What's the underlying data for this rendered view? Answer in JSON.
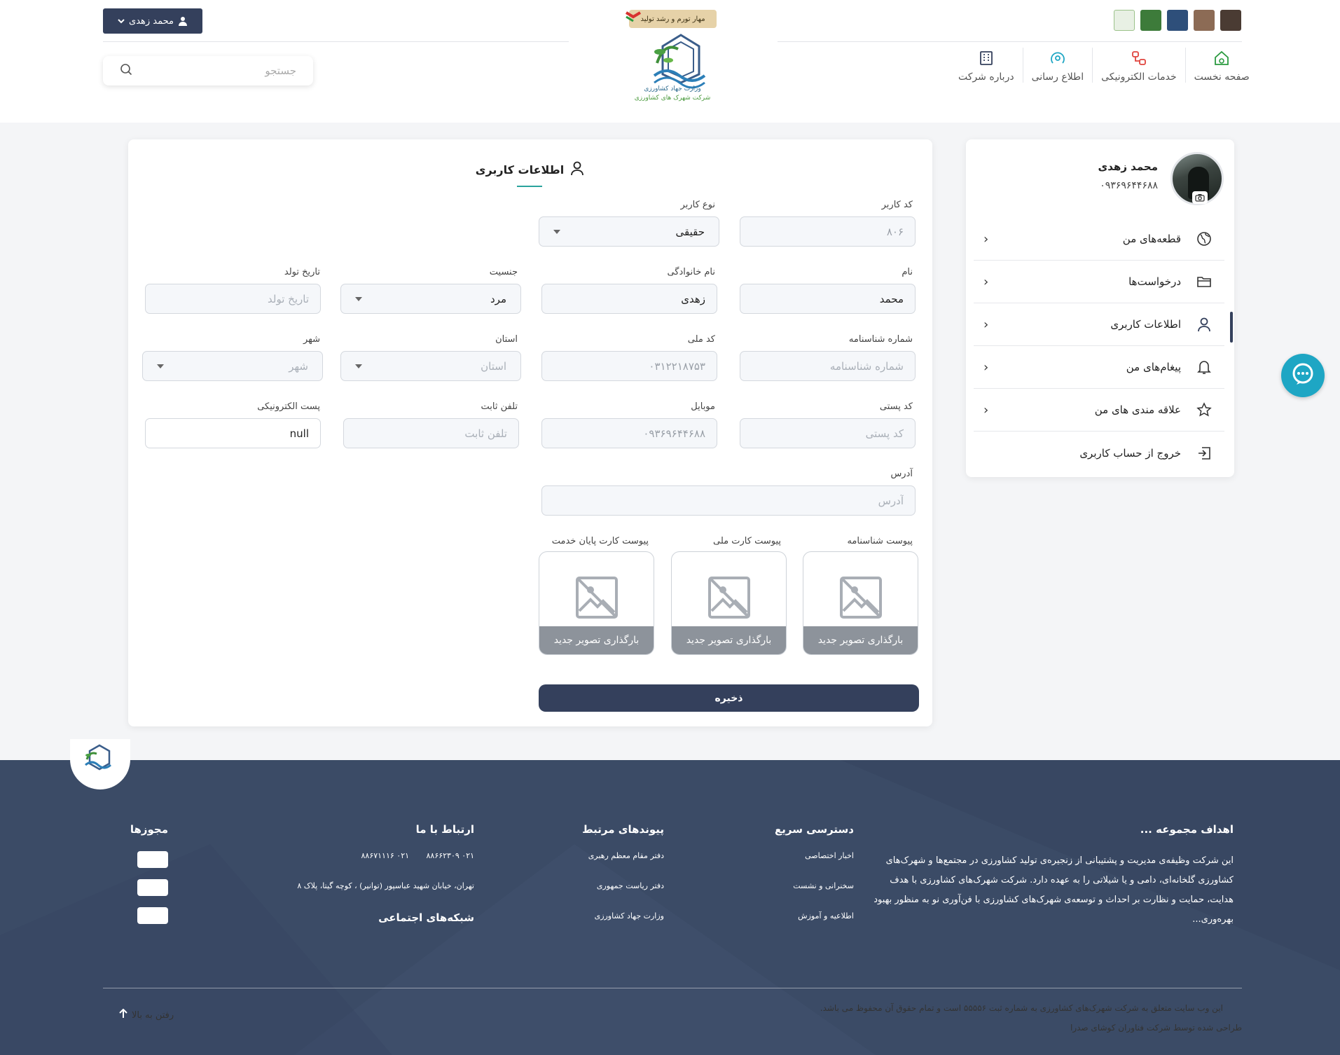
{
  "header": {
    "user_button_label": "محمد زهدی",
    "search_placeholder": "جستجو",
    "slogan_badge": "مهار تورم و رشد تولید",
    "logo_caption_ministry": "وزارت جهاد کشاورزی",
    "logo_caption_company": "شرکت شهرک های کشاورزی",
    "nav": [
      {
        "label": "صفحه نخست",
        "icon": "home-icon"
      },
      {
        "label": "خدمات الکترونیکی",
        "icon": "services-icon"
      },
      {
        "label": "اطلاع رسانی",
        "icon": "broadcast-icon"
      },
      {
        "label": "درباره شرکت",
        "icon": "building-icon"
      }
    ]
  },
  "form": {
    "title": "اطلاعات کاربری",
    "user_code": {
      "label": "کد کاربر",
      "value": "۸۰۶"
    },
    "user_type": {
      "label": "نوع کاربر",
      "value": "حقیقی"
    },
    "first_name": {
      "label": "نام",
      "value": "محمد"
    },
    "last_name": {
      "label": "نام خانوادگی",
      "value": "زهدی"
    },
    "gender": {
      "label": "جنسیت",
      "value": "مرد"
    },
    "birth_date": {
      "label": "تاریخ تولد",
      "placeholder": "تاریخ تولد"
    },
    "id_number": {
      "label": "شماره شناسنامه",
      "placeholder": "شماره شناسنامه"
    },
    "national_code": {
      "label": "کد ملی",
      "value": "۰۳۱۲۲۱۸۷۵۳"
    },
    "province": {
      "label": "استان",
      "placeholder": "استان"
    },
    "city": {
      "label": "شهر",
      "placeholder": "شهر"
    },
    "postal_code": {
      "label": "کد پستی",
      "placeholder": "کد پستی"
    },
    "mobile": {
      "label": "موبایل",
      "value": "۰۹۳۶۹۶۴۴۶۸۸"
    },
    "phone": {
      "label": "تلفن ثابت",
      "placeholder": "تلفن ثابت"
    },
    "email": {
      "label": "پست الکترونیکی",
      "value": "null"
    },
    "address": {
      "label": "آدرس",
      "placeholder": "آدرس"
    },
    "uploads": [
      {
        "label": "پیوست شناسنامه",
        "button": "بارگذاری تصویر جدید"
      },
      {
        "label": "پیوست کارت ملی",
        "button": "بارگذاری تصویر جدید"
      },
      {
        "label": "پیوست کارت پایان خدمت",
        "button": "بارگذاری تصویر جدید"
      }
    ],
    "save_label": "ذخیره"
  },
  "sidebar": {
    "name": "محمد زهدی",
    "phone": "۰۹۳۶۹۶۴۴۶۸۸",
    "items": [
      {
        "label": "قطعه‌های من",
        "icon": "globe-icon"
      },
      {
        "label": "درخواست‌ها",
        "icon": "folder-icon"
      },
      {
        "label": "اطلاعات کاربری",
        "icon": "user-icon",
        "active": true
      },
      {
        "label": "پیغام‌های من",
        "icon": "bell-icon"
      },
      {
        "label": "علاقه مندی های من",
        "icon": "star-icon"
      },
      {
        "label": "خروج از حساب کاربری",
        "icon": "logout-icon"
      }
    ]
  },
  "footer": {
    "goals_title": "اهداف مجموعه ...",
    "goals_text": "این شرکت وظیفه‌ی مدیریت و پشتیبانی از زنجیره‌ی تولید کشاورزی در مجتمع‌ها و شهرک‌های کشاورزی گلخانه‌ای، دامی و یا شیلاتی را به عهده دارد. شرکت شهرک‌های کشاورزی با هدف هدایت، حمایت و نظارت بر احداث و توسعه‌ی شهرک‌های کشاورزی با فن‌آوری نو به منظور بهبود بهره‌وری...",
    "quick_title": "دسترسی سریع",
    "quick_links": [
      "اخبار اختصاصی",
      "سخنرانی و نشست",
      "اطلاعیه و آموزش"
    ],
    "related_title": "پیوندهای مرتبط",
    "related_links": [
      "دفتر مقام معظم رهبری",
      "دفتر ریاست جمهوری",
      "وزارت جهاد کشاورزی"
    ],
    "contact_title": "ارتباط با ما",
    "phone1": "۰۲۱ ۸۸۶۶۲۳۰۹",
    "phone2": "۰۲۱ ۸۸۶۷۱۱۱۶",
    "address": "تهران، خیابان شهید عباسپور (توانیر) ، کوچه گیتا، پلاک ۸",
    "social_title": "شبکه‌های اجتماعی",
    "licenses_title": "مجوزها",
    "copyright": "این وب سایت متعلق به شرکت شهرک‌های کشاورزی به شماره ثبت ۵۵۵۵۶ است و تمام حقوق آن محفوظ می باشد.",
    "designer": "طراحی شده توسط شرکت فناوران کوشای صدرا",
    "back_to_top": "رفتن به بالا"
  },
  "colors": {
    "primary": "#34405c",
    "accent": "#2aa39d",
    "footer_bg": "#3b4b66",
    "chat_fab": "#1ea6c4"
  }
}
